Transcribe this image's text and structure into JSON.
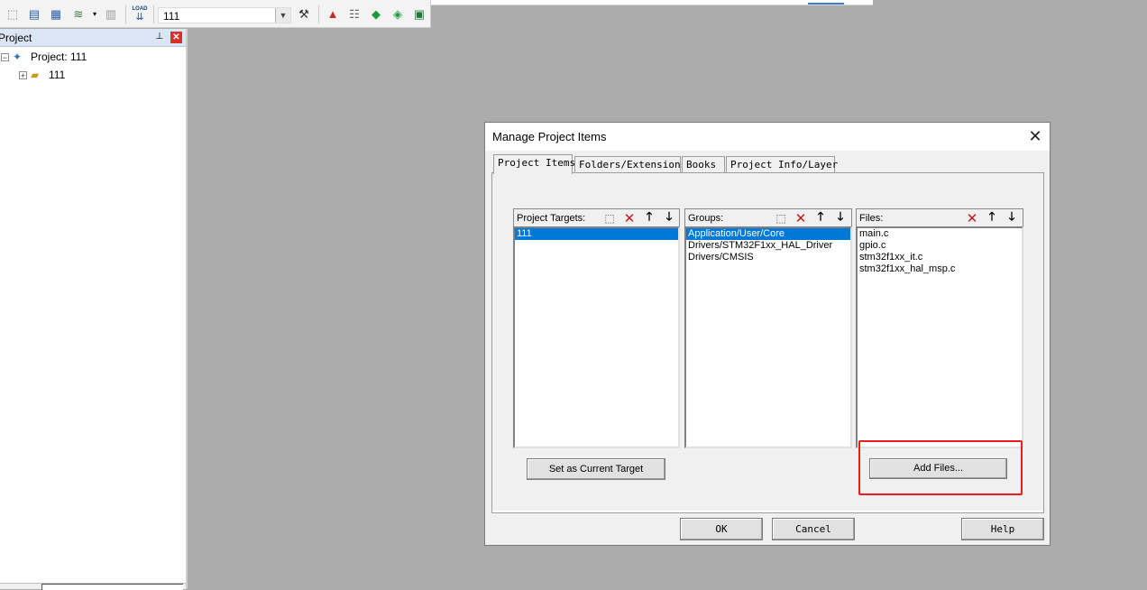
{
  "toolbar": {
    "target_value": "111",
    "load_label": "LOAD",
    "icons": [
      "translate-icon",
      "build-icon",
      "rebuild-icon",
      "batch-build-icon",
      "stop-build-icon",
      "download-icon",
      "target-options-icon",
      "manage-components-icon",
      "pack-installer-icon",
      "select-software-packs-icon",
      "run-time-environment-icon"
    ]
  },
  "project_pane": {
    "title": "Project",
    "tree": [
      {
        "label": "Project: 111"
      },
      {
        "label": "111"
      }
    ]
  },
  "dialog": {
    "title": "Manage Project Items",
    "tabs": [
      "Project Items",
      "Folders/Extensions",
      "Books",
      "Project Info/Layer"
    ],
    "active_tab": "Project Items",
    "targets": {
      "label": "Project Targets:",
      "items": [
        "111"
      ],
      "selected": "111"
    },
    "groups": {
      "label": "Groups:",
      "items": [
        "Application/User/Core",
        "Drivers/STM32F1xx_HAL_Driver",
        "Drivers/CMSIS"
      ],
      "selected": "Application/User/Core"
    },
    "files": {
      "label": "Files:",
      "items": [
        "main.c",
        "gpio.c",
        "stm32f1xx_it.c",
        "stm32f1xx_hal_msp.c"
      ]
    },
    "set_current_target_label": "Set as Current Target",
    "add_files_label": "Add Files...",
    "ok_label": "OK",
    "cancel_label": "Cancel",
    "help_label": "Help"
  },
  "colors": {
    "selection": "#0078d7",
    "highlight_box": "#ee1c1c",
    "workspace_bg": "#ababab",
    "pane_header": "#dbe6f4"
  }
}
